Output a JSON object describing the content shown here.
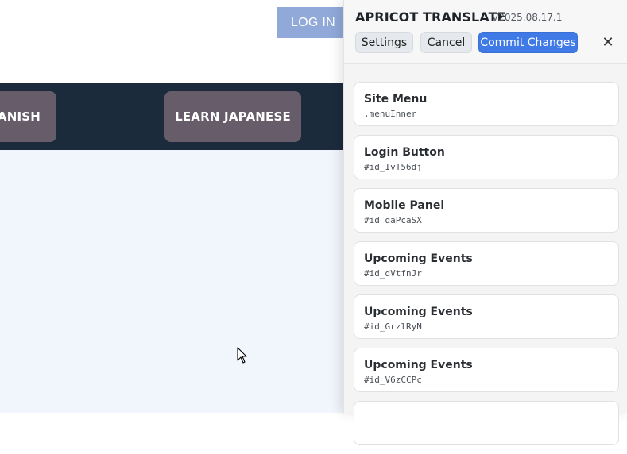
{
  "site": {
    "login_label": "LOG IN",
    "nav": {
      "left_pill": "PANISH",
      "right_pill": "LEARN JAPANESE"
    }
  },
  "panel": {
    "brand": "APRICOT TRANSLATE",
    "version": "V2025.08.17.1",
    "buttons": {
      "settings": "Settings",
      "cancel": "Cancel",
      "commit": "Commit Changes",
      "close": "✕"
    },
    "items": [
      {
        "name": "Site Menu",
        "selector": ".menuInner"
      },
      {
        "name": "Login Button",
        "selector": "#id_IvT56dj"
      },
      {
        "name": "Mobile Panel",
        "selector": "#id_daPcaSX"
      },
      {
        "name": "Upcoming Events",
        "selector": "#id_dVtfnJr"
      },
      {
        "name": "Upcoming Events",
        "selector": "#id_GrzlRyN"
      },
      {
        "name": "Upcoming Events",
        "selector": "#id_V6zCCPc"
      },
      {
        "name": "",
        "selector": ""
      }
    ]
  },
  "colors": {
    "navbar": "#1c2b3c",
    "nav_pill": "#675d6a",
    "login_button": "#90a9d9",
    "commit_button": "#3f7ae6",
    "site_body": "#f1f5fc"
  }
}
